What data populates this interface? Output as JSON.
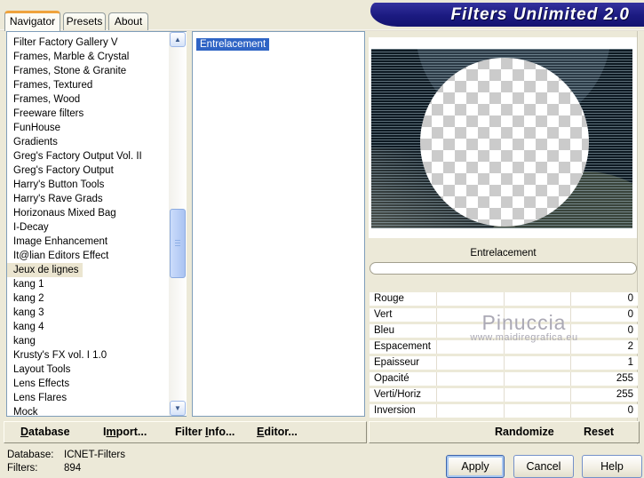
{
  "window": {
    "title": "Filters Unlimited 2.0"
  },
  "tabs": [
    {
      "label": "Navigator",
      "active": true
    },
    {
      "label": "Presets",
      "active": false
    },
    {
      "label": "About",
      "active": false
    }
  ],
  "navigator": {
    "categories": [
      {
        "label": "Filter Factory Gallery V"
      },
      {
        "label": "Frames, Marble & Crystal"
      },
      {
        "label": "Frames, Stone & Granite"
      },
      {
        "label": "Frames, Textured"
      },
      {
        "label": "Frames, Wood"
      },
      {
        "label": "Freeware filters"
      },
      {
        "label": "FunHouse"
      },
      {
        "label": "Gradients"
      },
      {
        "label": "Greg's Factory Output Vol. II"
      },
      {
        "label": "Greg's Factory Output"
      },
      {
        "label": "Harry's Button Tools"
      },
      {
        "label": "Harry's Rave Grads"
      },
      {
        "label": "Horizonaus Mixed Bag"
      },
      {
        "label": "I-Decay"
      },
      {
        "label": "Image Enhancement"
      },
      {
        "label": "It@lian Editors Effect"
      },
      {
        "label": "Jeux de lignes",
        "selected": true
      },
      {
        "label": "kang 1"
      },
      {
        "label": "kang 2"
      },
      {
        "label": "kang 3"
      },
      {
        "label": "kang 4"
      },
      {
        "label": "kang"
      },
      {
        "label": "Krusty's FX vol. I 1.0"
      },
      {
        "label": "Layout Tools"
      },
      {
        "label": "Lens Effects"
      },
      {
        "label": "Lens Flares"
      },
      {
        "label": "Mock"
      }
    ],
    "filters": [
      {
        "label": "Entrelacement",
        "selected": true
      }
    ]
  },
  "preview": {
    "caption": "Entrelacement",
    "progress_percent": 0
  },
  "parameters": [
    {
      "name": "Rouge",
      "value": 0
    },
    {
      "name": "Vert",
      "value": 0
    },
    {
      "name": "Bleu",
      "value": 0
    },
    {
      "name": "Espacement",
      "value": 2
    },
    {
      "name": "Epaisseur",
      "value": 1
    },
    {
      "name": "Opacité",
      "value": 255
    },
    {
      "name": "Verti/Horiz",
      "value": 255
    },
    {
      "name": "Inversion",
      "value": 0
    }
  ],
  "watermark": {
    "line1": "Pinuccia",
    "line2": "www.maidiregrafica.eu"
  },
  "toolbar": {
    "database": {
      "pre": "",
      "mn": "D",
      "post": "atabase"
    },
    "import": {
      "pre": "I",
      "mn": "m",
      "post": "port..."
    },
    "filter_info": {
      "pre": "Filter ",
      "mn": "I",
      "post": "nfo..."
    },
    "editor": {
      "pre": "",
      "mn": "E",
      "post": "ditor..."
    },
    "randomize": "Randomize",
    "reset": "Reset"
  },
  "status": {
    "database_label": "Database:",
    "database_value": "ICNET-Filters",
    "filters_label": "Filters:",
    "filters_value": "894"
  },
  "action_buttons": {
    "apply": "Apply",
    "cancel": "Cancel",
    "help": "Help"
  },
  "icons": {
    "scroll_up": "▲",
    "scroll_down": "▼"
  },
  "colors": {
    "banner": "#1b1a80",
    "dialog": "#ece9d8",
    "selection_blue": "#2f64c5",
    "tab_accent": "#efa33c",
    "watermark_gray": "#aba9b5",
    "preview_background": "#0d1922"
  }
}
